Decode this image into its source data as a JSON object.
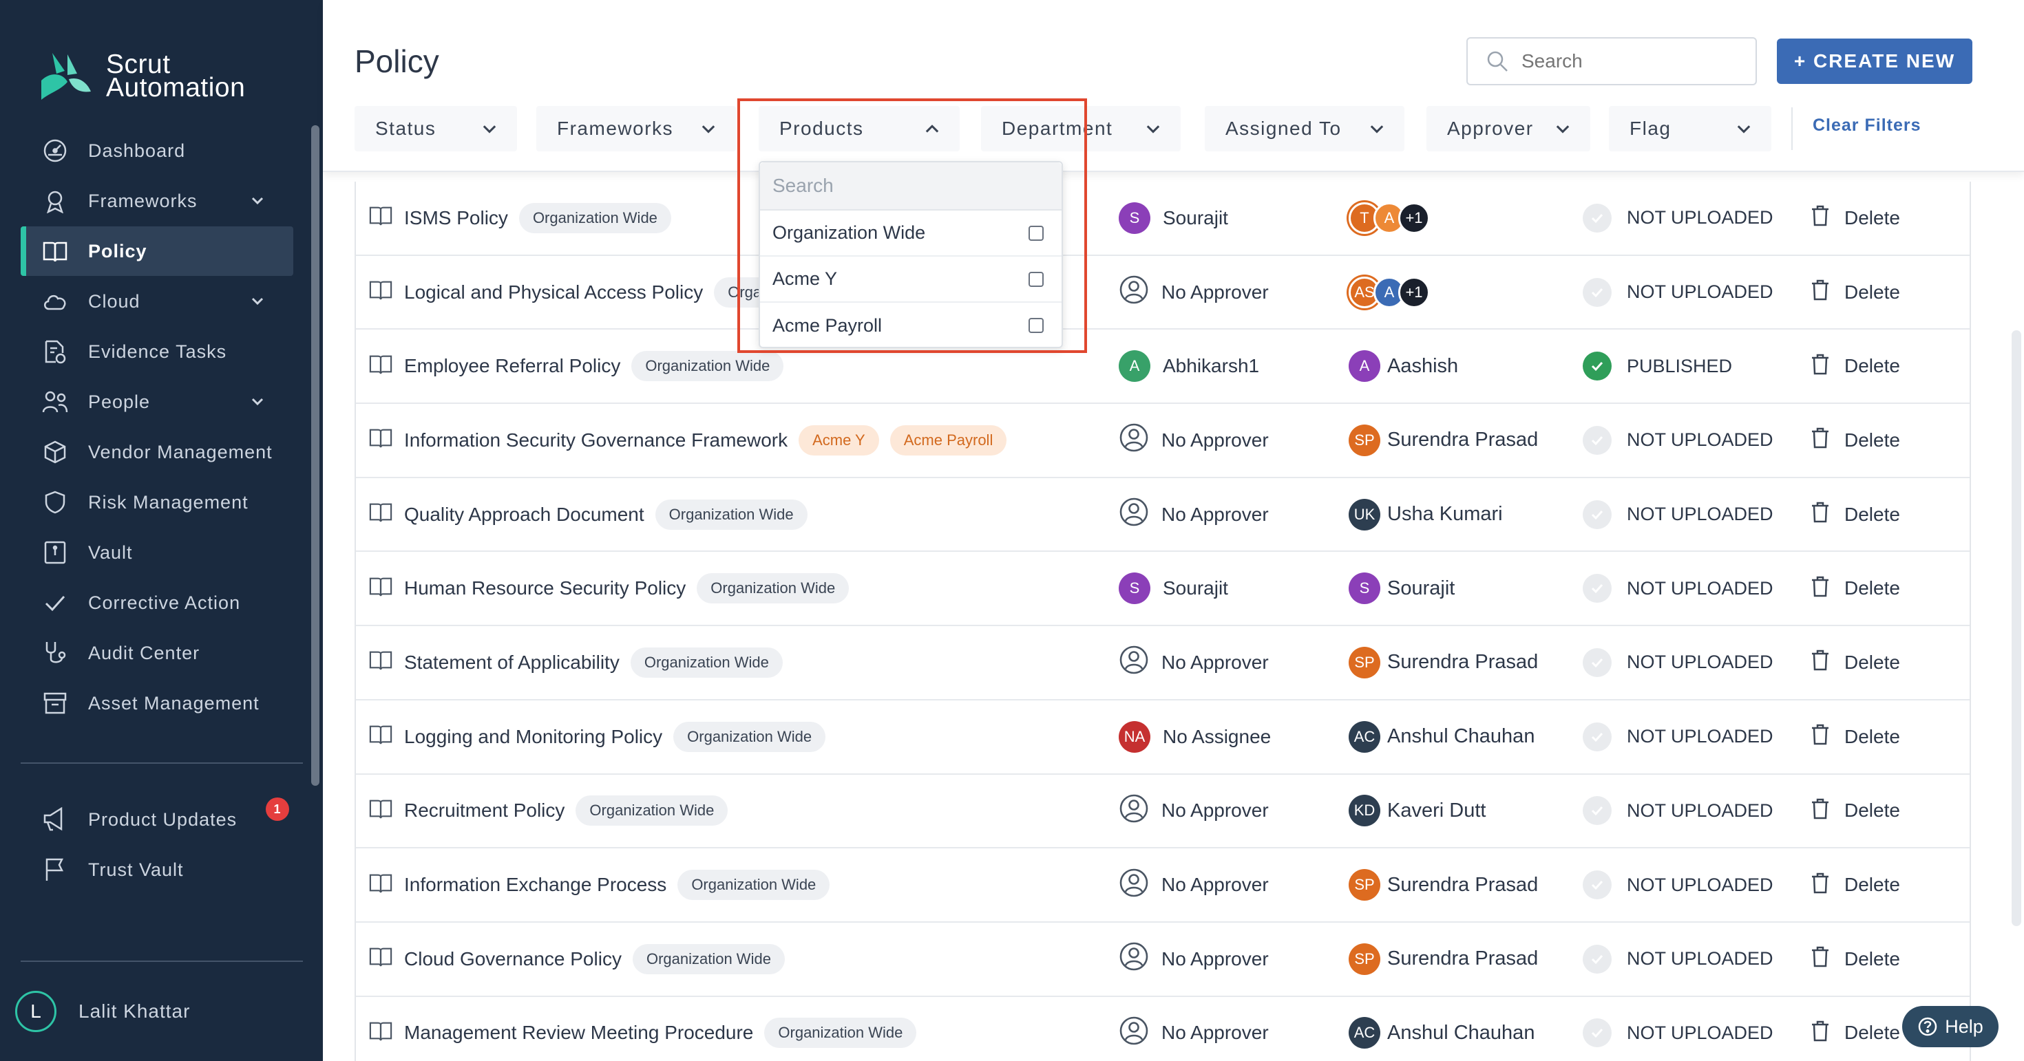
{
  "app": {
    "brand_line1": "Scrut",
    "brand_line2": "Automation",
    "accent_color": "#2ec4a6",
    "sidebar_color": "#1a2a3f"
  },
  "sidebar": {
    "items": [
      {
        "label": "Dashboard",
        "icon": "dashboard-icon"
      },
      {
        "label": "Frameworks",
        "icon": "frameworks-icon",
        "expandable": true
      },
      {
        "label": "Policy",
        "icon": "book-icon",
        "active": true
      },
      {
        "label": "Cloud",
        "icon": "cloud-icon",
        "expandable": true
      },
      {
        "label": "Evidence Tasks",
        "icon": "evidence-icon"
      },
      {
        "label": "People",
        "icon": "people-icon",
        "expandable": true
      },
      {
        "label": "Vendor Management",
        "icon": "box-icon"
      },
      {
        "label": "Risk Management",
        "icon": "shield-icon"
      },
      {
        "label": "Vault",
        "icon": "vault-icon"
      },
      {
        "label": "Corrective Action",
        "icon": "check-icon"
      },
      {
        "label": "Audit Center",
        "icon": "stethoscope-icon"
      },
      {
        "label": "Asset Management",
        "icon": "archive-icon"
      }
    ],
    "bottom_items": [
      {
        "label": "Product Updates",
        "icon": "megaphone-icon",
        "badge": "1"
      },
      {
        "label": "Trust Vault",
        "icon": "flag-icon"
      }
    ],
    "user": {
      "initial": "L",
      "name": "Lalit Khattar"
    }
  },
  "header": {
    "title": "Policy",
    "search_placeholder": "Search",
    "create_label": "+ CREATE NEW",
    "filters": [
      "Status",
      "Frameworks",
      "Products",
      "Department",
      "Assigned To",
      "Approver",
      "Flag"
    ],
    "clear_filters": "Clear Filters"
  },
  "products_dropdown": {
    "search_placeholder": "Search",
    "options": [
      "Organization Wide",
      "Acme Y",
      "Acme Payroll"
    ]
  },
  "policies": [
    {
      "name": "ISMS Policy",
      "tags": [
        "Organization Wide"
      ],
      "approver": "Sourajit",
      "approver_initials": "S",
      "approver_color": "#8b3fb8",
      "assigned_stack": [
        "T",
        "A",
        "+1"
      ],
      "status": "NOT UPLOADED",
      "action": "Delete"
    },
    {
      "name": "Logical and Physical Access Policy",
      "tags": [
        "Organiz"
      ],
      "approver": "No Approver",
      "approver_initials": "",
      "approver_color": "",
      "assigned_stack": [
        "AS",
        "A",
        "+1"
      ],
      "status": "NOT UPLOADED",
      "action": "Delete"
    },
    {
      "name": "Employee Referral Policy",
      "tags": [
        "Organization Wide"
      ],
      "approver": "Abhikarsh1",
      "approver_initials": "A",
      "approver_color": "#38a169",
      "assigned": "Aashish",
      "assigned_initials": "A",
      "assigned_color": "#8b3fb8",
      "status": "PUBLISHED",
      "action": "Delete"
    },
    {
      "name": "Information Security Governance Framework",
      "tags": [
        "Acme Y",
        "Acme Payroll"
      ],
      "tag_style": "orange",
      "approver": "No Approver",
      "approver_initials": "",
      "approver_color": "",
      "assigned": "Surendra Prasad",
      "assigned_initials": "SP",
      "assigned_color": "#dd6b20",
      "status": "NOT UPLOADED",
      "action": "Delete"
    },
    {
      "name": "Quality Approach Document",
      "tags": [
        "Organization Wide"
      ],
      "approver": "No Approver",
      "approver_initials": "",
      "approver_color": "",
      "assigned": "Usha Kumari",
      "assigned_initials": "UK",
      "assigned_color": "#2d3e50",
      "status": "NOT UPLOADED",
      "action": "Delete"
    },
    {
      "name": "Human Resource Security Policy",
      "tags": [
        "Organization Wide"
      ],
      "approver": "Sourajit",
      "approver_initials": "S",
      "approver_color": "#8b3fb8",
      "assigned": "Sourajit",
      "assigned_initials": "S",
      "assigned_color": "#8b3fb8",
      "status": "NOT UPLOADED",
      "action": "Delete"
    },
    {
      "name": "Statement of Applicability",
      "tags": [
        "Organization Wide"
      ],
      "approver": "No Approver",
      "approver_initials": "",
      "approver_color": "",
      "assigned": "Surendra Prasad",
      "assigned_initials": "SP",
      "assigned_color": "#dd6b20",
      "status": "NOT UPLOADED",
      "action": "Delete"
    },
    {
      "name": "Logging and Monitoring Policy",
      "tags": [
        "Organization Wide"
      ],
      "approver": "No Assignee",
      "approver_initials": "NA",
      "approver_color": "#c53030",
      "assigned": "Anshul Chauhan",
      "assigned_initials": "AC",
      "assigned_color": "#2d3e50",
      "status": "NOT UPLOADED",
      "action": "Delete"
    },
    {
      "name": "Recruitment Policy",
      "tags": [
        "Organization Wide"
      ],
      "approver": "No Approver",
      "approver_initials": "",
      "approver_color": "",
      "assigned": "Kaveri Dutt",
      "assigned_initials": "KD",
      "assigned_color": "#2d3e50",
      "status": "NOT UPLOADED",
      "action": "Delete"
    },
    {
      "name": "Information Exchange Process",
      "tags": [
        "Organization Wide"
      ],
      "approver": "No Approver",
      "approver_initials": "",
      "approver_color": "",
      "assigned": "Surendra Prasad",
      "assigned_initials": "SP",
      "assigned_color": "#dd6b20",
      "status": "NOT UPLOADED",
      "action": "Delete"
    },
    {
      "name": "Cloud Governance Policy",
      "tags": [
        "Organization Wide"
      ],
      "approver": "No Approver",
      "approver_initials": "",
      "approver_color": "",
      "assigned": "Surendra Prasad",
      "assigned_initials": "SP",
      "assigned_color": "#dd6b20",
      "status": "NOT UPLOADED",
      "action": "Delete"
    },
    {
      "name": "Management Review Meeting Procedure",
      "tags": [
        "Organization Wide"
      ],
      "approver": "No Approver",
      "approver_initials": "",
      "approver_color": "",
      "assigned": "Anshul Chauhan",
      "assigned_initials": "AC",
      "assigned_color": "#2d3e50",
      "status": "NOT UPLOADED",
      "action": "Delete"
    }
  ],
  "help_label": "Help"
}
